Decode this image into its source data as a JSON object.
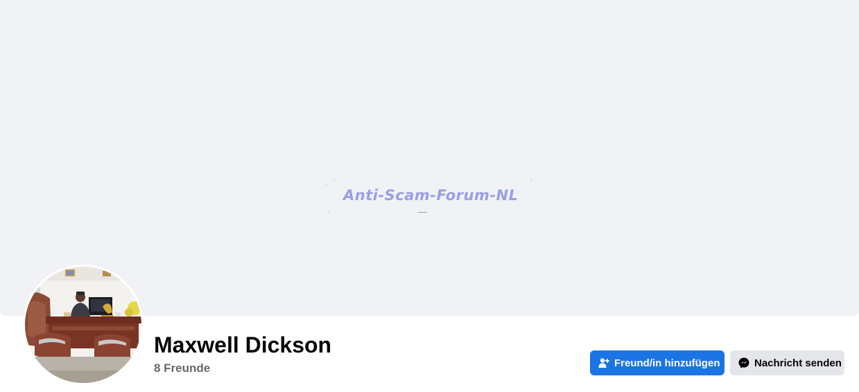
{
  "cover": {
    "watermark_text": "Anti-Scam-Forum-NL",
    "background_color": "#f0f2f5",
    "watermark_color": "#9c9ee8"
  },
  "profile": {
    "name": "Maxwell Dickson",
    "friends_count_label": "8 Freunde",
    "avatar": "profile-photo-man-at-office-desk"
  },
  "actions": {
    "add_friend_label": "Freund/in hinzufügen",
    "add_friend_icon": "person-add-icon",
    "message_label": "Nachricht senden",
    "message_icon": "messenger-icon"
  },
  "colors": {
    "primary": "#1b74e4",
    "secondary": "#e4e6eb",
    "text": "#050505",
    "muted": "#65676b"
  }
}
